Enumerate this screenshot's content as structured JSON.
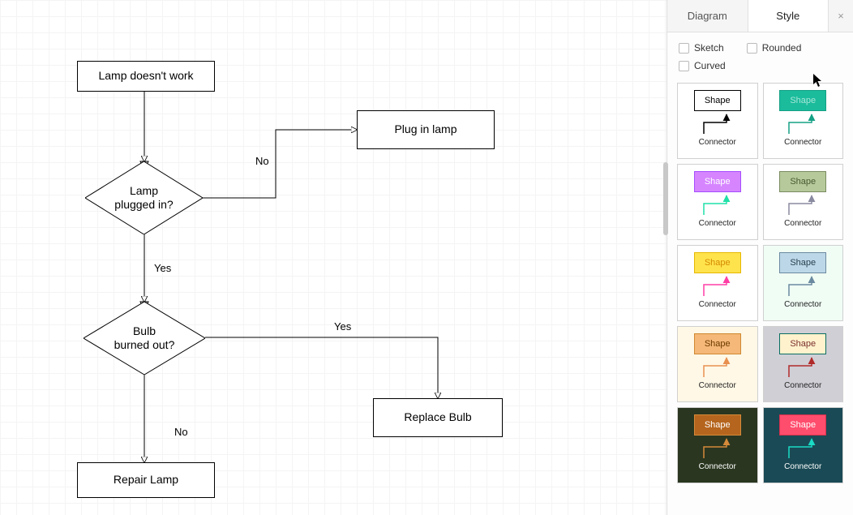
{
  "sidebar": {
    "tabs": [
      "Diagram",
      "Style"
    ],
    "active_tab": "Style",
    "options": {
      "sketch": "Sketch",
      "rounded": "Rounded",
      "curved": "Curved"
    },
    "swatch_shape_label": "Shape",
    "swatch_connector_label": "Connector",
    "styles": [
      {
        "card_bg": "#ffffff",
        "shape_bg": "#ffffff",
        "shape_border": "#000000",
        "shape_text": "#000000",
        "conn_color": "#000000"
      },
      {
        "card_bg": "#ffffff",
        "shape_bg": "#1abc9c",
        "shape_border": "#16a085",
        "shape_text": "#a8e6d8",
        "conn_color": "#16a085"
      },
      {
        "card_bg": "#ffffff",
        "shape_bg": "#d685ff",
        "shape_border": "#a64dff",
        "shape_text": "#ffffff",
        "conn_color": "#1fe0a8"
      },
      {
        "card_bg": "#ffffff",
        "shape_bg": "#b5c99a",
        "shape_border": "#7a8b61",
        "shape_text": "#4a5a34",
        "conn_color": "#8a8aa0"
      },
      {
        "card_bg": "#ffffff",
        "shape_bg": "#ffe34d",
        "shape_border": "#e6b800",
        "shape_text": "#d48a00",
        "conn_color": "#ff3ea5"
      },
      {
        "card_bg": "#f0fdf5",
        "shape_bg": "#bcd8e8",
        "shape_border": "#6b8aa0",
        "shape_text": "#2a4050",
        "conn_color": "#6b8aa0"
      },
      {
        "card_bg": "#fff8e6",
        "shape_bg": "#f5b878",
        "shape_border": "#d08830",
        "shape_text": "#6b3a00",
        "conn_color": "#e89050"
      },
      {
        "card_bg": "#d0cfd6",
        "shape_bg": "#fff2cc",
        "shape_border": "#0a6e62",
        "shape_text": "#7a3030",
        "conn_color": "#b02a2a"
      },
      {
        "card_bg": "#2a3620",
        "shape_bg": "#b5651d",
        "shape_border": "#d68a3a",
        "shape_text": "#ffffff",
        "conn_color": "#d68a3a"
      },
      {
        "card_bg": "#1a4a55",
        "shape_bg": "#ff4d6d",
        "shape_border": "#d6304d",
        "shape_text": "#ffffff",
        "conn_color": "#1adbc5"
      }
    ]
  },
  "diagram": {
    "nodes": {
      "start": "Lamp doesn't work",
      "plugged_in": "Lamp\nplugged in?",
      "plug_in": "Plug in lamp",
      "burned_out": "Bulb\nburned out?",
      "replace": "Replace Bulb",
      "repair": "Repair Lamp"
    },
    "edge_labels": {
      "no1": "No",
      "yes1": "Yes",
      "yes2": "Yes",
      "no2": "No"
    }
  }
}
